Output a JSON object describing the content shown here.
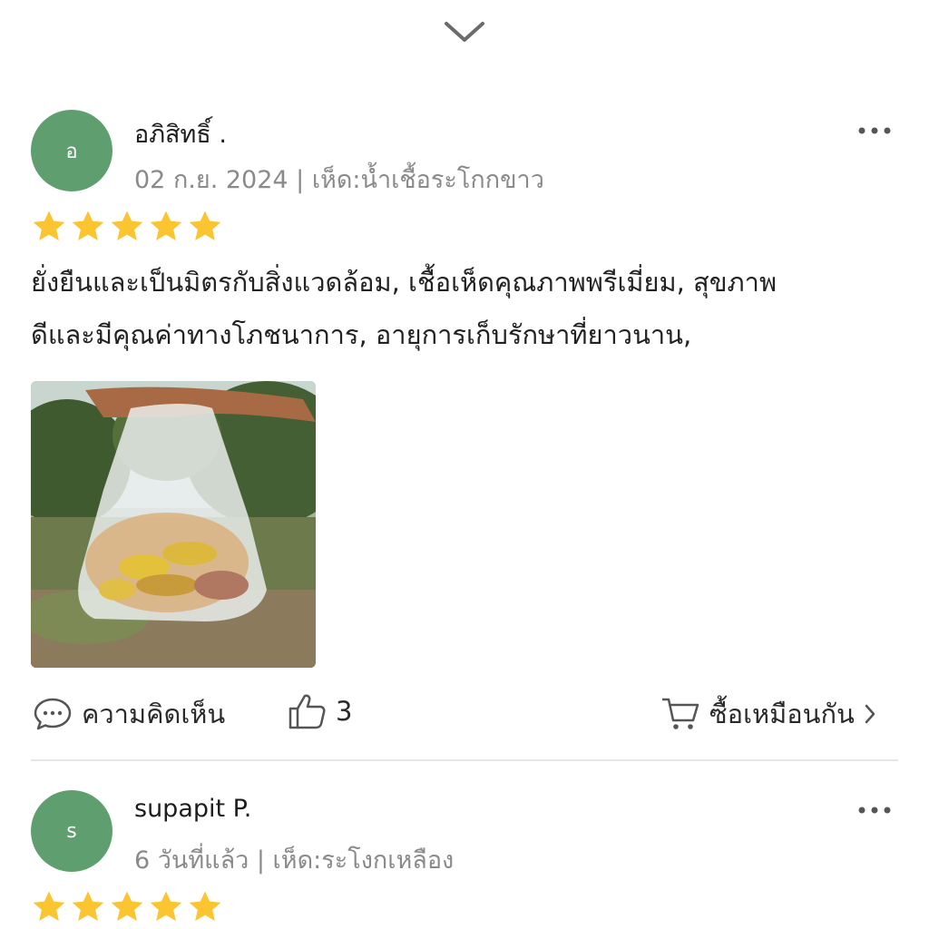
{
  "collapse_icon": "chevron-down-icon",
  "colors": {
    "avatar": "#5f9e6f",
    "star": "#fbc531",
    "meta_text": "#8a8a8a",
    "divider": "#e6e6e6"
  },
  "reviews": [
    {
      "avatar_letter": "อ",
      "name": "อภิสิทธิ์ .",
      "meta": "02 ก.ย. 2024 | เห็ด:น้ำเชื้อระโกกขาว",
      "rating": 5,
      "text_line1": "ยั่งยืนและเป็นมิตรกับสิ่งแวดล้อม, เชื้อเห็ดคุณภาพพรีเมี่ยม, สุขภาพ",
      "text_line2": "ดีและมีคุณค่าทางโภชนาการ, อายุการเก็บรักษาที่ยาวนาน,",
      "actions": {
        "comment_label": "ความคิดเห็น",
        "like_count": "3",
        "buy_label": "ซื้อเหมือนกัน"
      }
    },
    {
      "avatar_letter": "s",
      "name": "supapit P.",
      "meta": "6 วันที่แล้ว | เห็ด:ระโงกเหลือง",
      "rating": 5
    }
  ]
}
